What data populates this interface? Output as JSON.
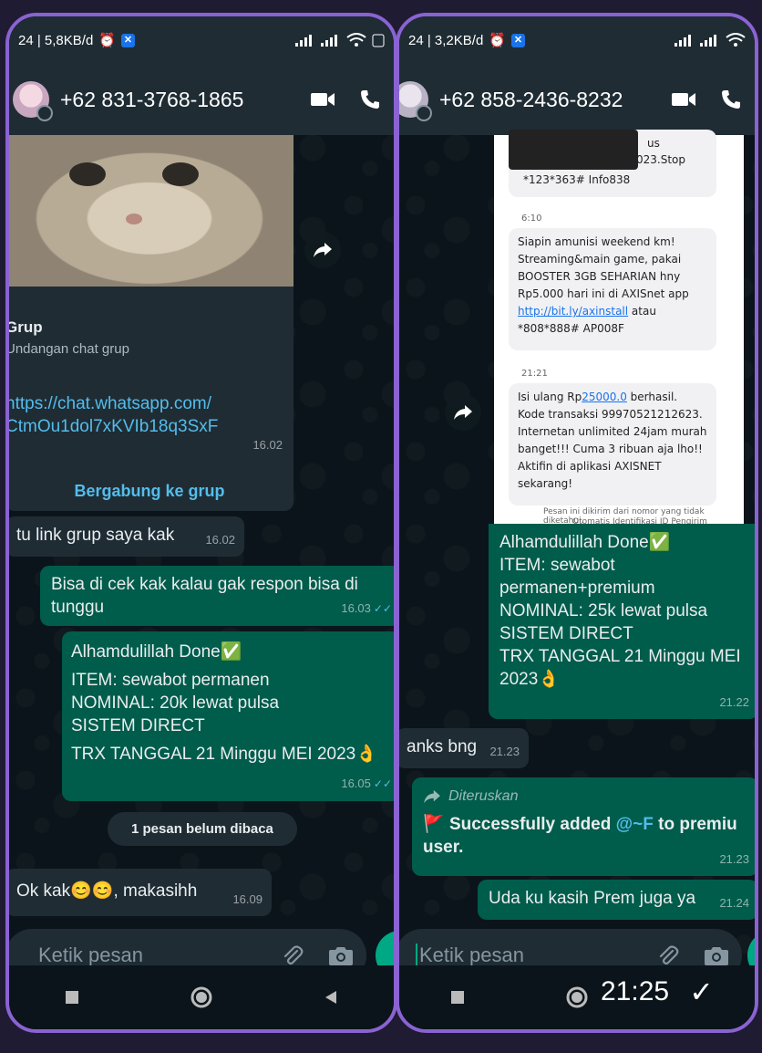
{
  "left": {
    "status": {
      "left": "24 | 5,8KB/d",
      "alarm": "⏰",
      "app": "✕"
    },
    "contact": "+62 831-3768-1865",
    "group_card": {
      "title": "Grup",
      "subtitle": "Undangan chat grup",
      "link": "https://chat.whatsapp.com/\nCtmOu1dol7xKVIb18q3SxF",
      "time": "16.02",
      "join": "Bergabung ke grup"
    },
    "msg1": {
      "text": "tu link grup saya kak",
      "time": "16.02"
    },
    "msg2": {
      "text": "Bisa di cek kak kalau gak respon bisa di tunggu",
      "time": "16.03"
    },
    "msg3": {
      "line1": "Alhamdulillah Done✅",
      "line2": "ITEM: sewabot permanen",
      "line3": "NOMINAL: 20k lewat pulsa",
      "line4": "SISTEM DIRECT",
      "line5": "TRX TANGGAL 21 Minggu MEI 2023👌",
      "time": "16.05"
    },
    "unread": "1 pesan belum dibaca",
    "msg4": {
      "text": "Ok kak😊😊, makasihh",
      "time": "16.09"
    },
    "composer": "Ketik pesan"
  },
  "right": {
    "status": {
      "left": "24 | 3,2KB/d",
      "alarm": "⏰",
      "app": "✕"
    },
    "contact": "+62 858-2436-8232",
    "sms": {
      "top_fragment_1": "us",
      "top_fragment_2": "023.Stop",
      "top_fragment_3": "*123*363# Info838",
      "meta1": "6:10",
      "msg1": "Siapin amunisi weekend km! Streaming&main game, pakai BOOSTER 3GB SEHARIAN hny Rp5.000 hari ini di AXISnet app ",
      "msg1_link": "http://bit.ly/axinstall",
      "msg1_tail": " atau *808*888# AP008F",
      "meta2": "21:21",
      "msg2_a": "Isi ulang Rp",
      "msg2_link": "25000.0",
      "msg2_b": " berhasil. Kode transaksi 99970521212623. Internetan unlimited 24jam murah banget!!! Cuma 3 ribuan aja lho!! Aktifin di aplikasi AXISNET sekarang!",
      "footer": "Pesan ini dikirim dari nomor yang tidak diketahui.",
      "footer2": "Otomatis Identifikasi ID Pengirim"
    },
    "msg1": {
      "line1": "Alhamdulillah Done✅",
      "line2": "ITEM: sewabot",
      "line3": "permanen+premium",
      "line4": "NOMINAL: 25k lewat pulsa",
      "line5": "SISTEM DIRECT",
      "line6": "TRX TANGGAL 21 Minggu MEI",
      "line7": "2023👌",
      "time": "21.22"
    },
    "msg2": {
      "text": "anks bng",
      "time": "21.23"
    },
    "forwarded": {
      "label": "Diteruskan",
      "flag": "🚩",
      "text_a": " Successfully added ",
      "mention": "@~F",
      "text_b": " to premiu",
      "line2": "user.",
      "time": "21.23"
    },
    "msg3": {
      "text": "Uda ku kasih Prem juga ya",
      "time": "21.24"
    },
    "composer": "Ketik pesan"
  },
  "overlay": {
    "clock": "21:25",
    "check": "✓"
  },
  "colors": {
    "frame": "#8a63d2",
    "header": "#1f2c34",
    "incoming": "#1f2c34",
    "outgoing": "#005c4b",
    "accent": "#00a884",
    "link": "#53bdeb"
  }
}
